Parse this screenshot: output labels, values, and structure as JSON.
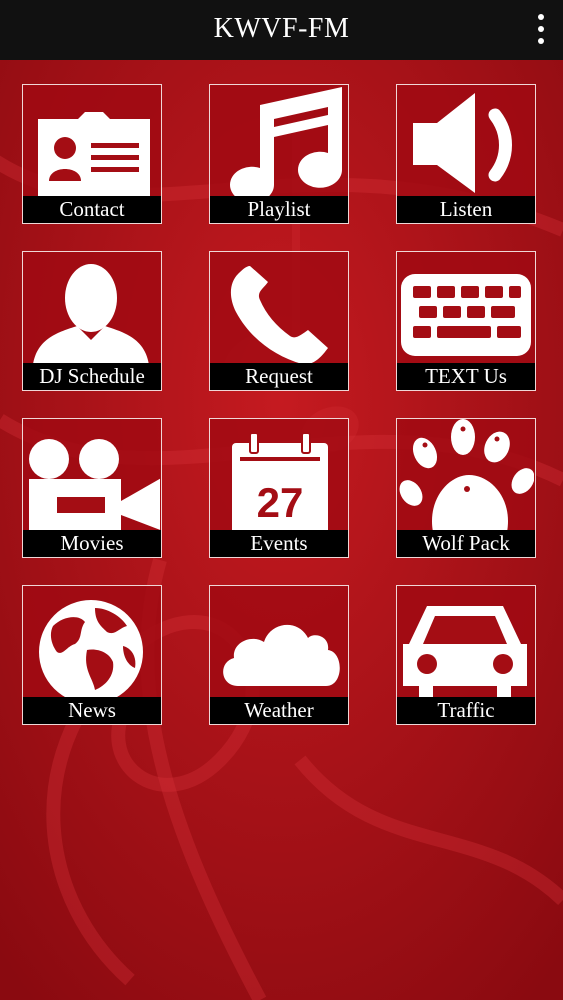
{
  "app": {
    "title": "KWVF-FM"
  },
  "colors": {
    "topbar": "#111111",
    "background": "#a40d14",
    "tile_border": "#f0d7d7",
    "label_bg": "#000000",
    "icon": "#ffffff"
  },
  "tiles": [
    {
      "label": "Contact",
      "icon": "id-card-icon"
    },
    {
      "label": "Playlist",
      "icon": "music-notes-icon"
    },
    {
      "label": "Listen",
      "icon": "speaker-icon"
    },
    {
      "label": "DJ Schedule",
      "icon": "person-icon"
    },
    {
      "label": "Request",
      "icon": "phone-icon"
    },
    {
      "label": "TEXT Us",
      "icon": "keyboard-icon"
    },
    {
      "label": "Movies",
      "icon": "movie-camera-icon"
    },
    {
      "label": "Events",
      "icon": "calendar-icon",
      "icon_text": "27"
    },
    {
      "label": "Wolf Pack",
      "icon": "paw-icon"
    },
    {
      "label": "News",
      "icon": "globe-icon"
    },
    {
      "label": "Weather",
      "icon": "cloud-icon"
    },
    {
      "label": "Traffic",
      "icon": "car-icon"
    }
  ]
}
